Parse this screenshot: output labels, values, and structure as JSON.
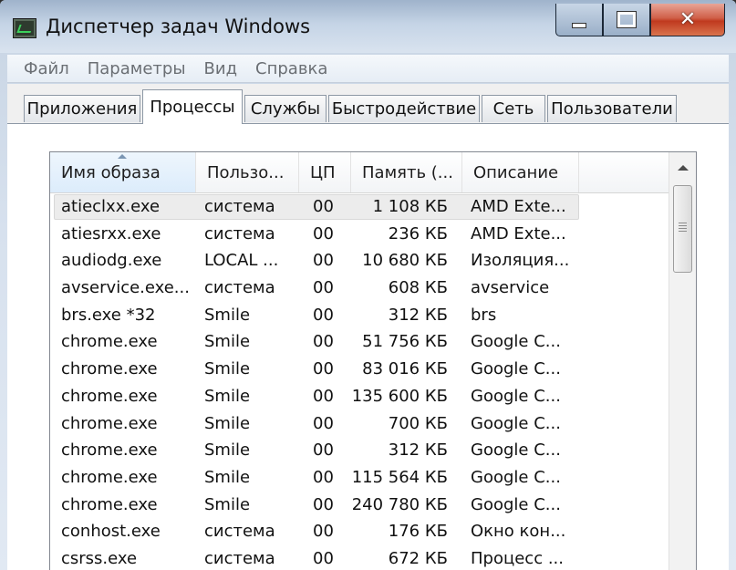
{
  "window": {
    "title": "Диспетчер задач Windows"
  },
  "menu": [
    "Файл",
    "Параметры",
    "Вид",
    "Справка"
  ],
  "tabs": [
    {
      "label": "Приложения"
    },
    {
      "label": "Процессы",
      "active": true
    },
    {
      "label": "Службы"
    },
    {
      "label": "Быстродействие"
    },
    {
      "label": "Сеть"
    },
    {
      "label": "Пользователи"
    }
  ],
  "columns": {
    "name": "Имя образа",
    "user": "Пользо...",
    "cpu": "ЦП",
    "mem": "Память (...",
    "desc": "Описание"
  },
  "rows": [
    [
      "atieclxx.exe",
      "система",
      "00",
      "1 108 КБ",
      "AMD Exte..."
    ],
    [
      "atiesrxx.exe",
      "система",
      "00",
      "236 КБ",
      "AMD Exte..."
    ],
    [
      "audiodg.exe",
      "LOCAL ...",
      "00",
      "10 680 КБ",
      "Изоляция..."
    ],
    [
      "avservice.exe...",
      "система",
      "00",
      "608 КБ",
      "avservice"
    ],
    [
      "brs.exe *32",
      "Smile",
      "00",
      "312 КБ",
      "brs"
    ],
    [
      "chrome.exe",
      "Smile",
      "00",
      "51 756 КБ",
      "Google C..."
    ],
    [
      "chrome.exe",
      "Smile",
      "00",
      "83 016 КБ",
      "Google C..."
    ],
    [
      "chrome.exe",
      "Smile",
      "00",
      "135 600 КБ",
      "Google C..."
    ],
    [
      "chrome.exe",
      "Smile",
      "00",
      "700 КБ",
      "Google C..."
    ],
    [
      "chrome.exe",
      "Smile",
      "00",
      "312 КБ",
      "Google C..."
    ],
    [
      "chrome.exe",
      "Smile",
      "00",
      "115 564 КБ",
      "Google C..."
    ],
    [
      "chrome.exe",
      "Smile",
      "00",
      "240 780 КБ",
      "Google C..."
    ],
    [
      "conhost.exe",
      "система",
      "00",
      "176 КБ",
      "Окно кон..."
    ],
    [
      "csrss.exe",
      "система",
      "00",
      "672 КБ",
      "Процесс ..."
    ]
  ],
  "selected_row": 0
}
